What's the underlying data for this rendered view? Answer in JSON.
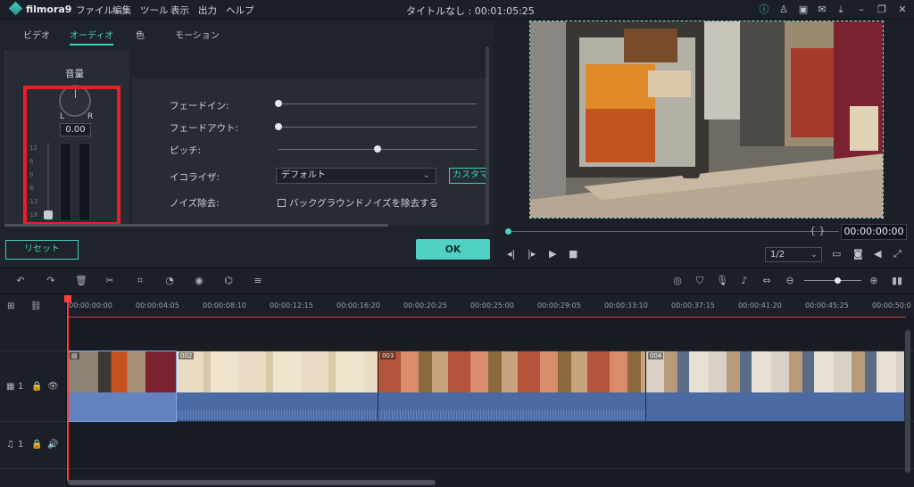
{
  "app": {
    "logo": "filmora9",
    "title": "タイトルなし : 00:01:05:25"
  },
  "menu": [
    "ファイル",
    "編集",
    "ツール",
    "表示",
    "出力",
    "ヘルプ"
  ],
  "window_icons": [
    "info-icon",
    "account-icon",
    "save-icon",
    "mail-icon",
    "download-icon",
    "minimize-icon",
    "restore-icon",
    "close-icon"
  ],
  "tabs": [
    "ビデオ",
    "オーディオ",
    "色",
    "モーション"
  ],
  "volume": {
    "label": "音量",
    "left": "L",
    "right": "R",
    "value": "0.00",
    "scale": [
      "12",
      "6",
      "0",
      "-6",
      "-12",
      "-18"
    ]
  },
  "settings": {
    "fade_in": "フェードイン:",
    "fade_in_level": 0,
    "fade_out": "フェードアウト:",
    "fade_out_level": 0,
    "pitch": "ピッチ:",
    "pitch_level": 0.5,
    "equalizer": "イコライザ:",
    "equalizer_value": "デフォルト",
    "custom": "カスタマイズ",
    "noise": "ノイズ除去:",
    "noise_option": "バックグラウンドノイズを除去する",
    "noise_checked": false
  },
  "buttons": {
    "reset": "リセット",
    "ok": "OK"
  },
  "preview": {
    "braces": "{  }",
    "timecode": "00:00:00:00",
    "quality": "1/2"
  },
  "ruler": [
    "00:00:00:00",
    "00:00:04:05",
    "00:00:08:10",
    "00:00:12:15",
    "00:00:16:20",
    "00:00:20:25",
    "00:00:25:00",
    "00:00:29:05",
    "00:00:33:10",
    "00:00:37:15",
    "00:00:41:20",
    "00:00:45:25",
    "00:00:50:0"
  ],
  "tracks": {
    "video_label": "1",
    "audio_label": "1",
    "clips": [
      "002",
      "003",
      "004"
    ]
  },
  "colors": {
    "accent": "#4fd1c3",
    "highlight": "#ee1c24",
    "playhead": "#ff3d3d"
  }
}
